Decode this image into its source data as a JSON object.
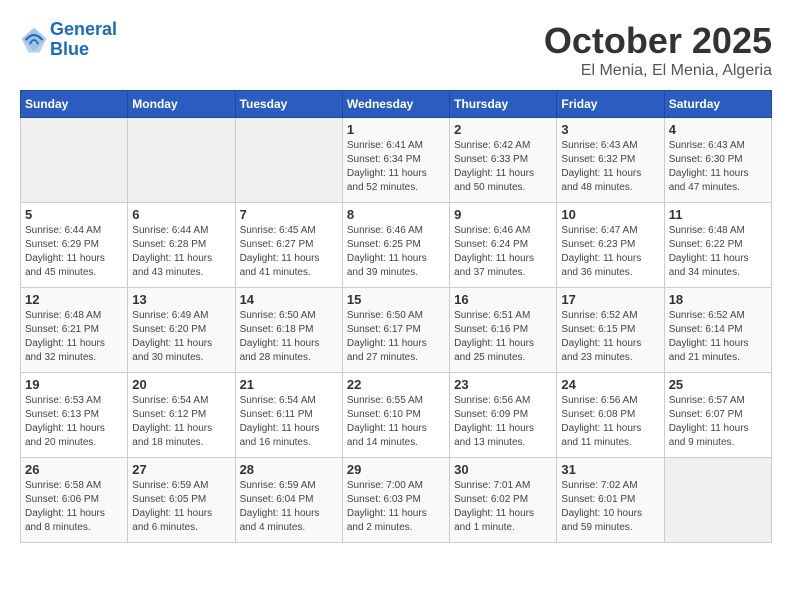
{
  "header": {
    "logo_line1": "General",
    "logo_line2": "Blue",
    "month": "October 2025",
    "location": "El Menia, El Menia, Algeria"
  },
  "days_of_week": [
    "Sunday",
    "Monday",
    "Tuesday",
    "Wednesday",
    "Thursday",
    "Friday",
    "Saturday"
  ],
  "weeks": [
    [
      {
        "day": "",
        "info": ""
      },
      {
        "day": "",
        "info": ""
      },
      {
        "day": "",
        "info": ""
      },
      {
        "day": "1",
        "info": "Sunrise: 6:41 AM\nSunset: 6:34 PM\nDaylight: 11 hours and 52 minutes."
      },
      {
        "day": "2",
        "info": "Sunrise: 6:42 AM\nSunset: 6:33 PM\nDaylight: 11 hours and 50 minutes."
      },
      {
        "day": "3",
        "info": "Sunrise: 6:43 AM\nSunset: 6:32 PM\nDaylight: 11 hours and 48 minutes."
      },
      {
        "day": "4",
        "info": "Sunrise: 6:43 AM\nSunset: 6:30 PM\nDaylight: 11 hours and 47 minutes."
      }
    ],
    [
      {
        "day": "5",
        "info": "Sunrise: 6:44 AM\nSunset: 6:29 PM\nDaylight: 11 hours and 45 minutes."
      },
      {
        "day": "6",
        "info": "Sunrise: 6:44 AM\nSunset: 6:28 PM\nDaylight: 11 hours and 43 minutes."
      },
      {
        "day": "7",
        "info": "Sunrise: 6:45 AM\nSunset: 6:27 PM\nDaylight: 11 hours and 41 minutes."
      },
      {
        "day": "8",
        "info": "Sunrise: 6:46 AM\nSunset: 6:25 PM\nDaylight: 11 hours and 39 minutes."
      },
      {
        "day": "9",
        "info": "Sunrise: 6:46 AM\nSunset: 6:24 PM\nDaylight: 11 hours and 37 minutes."
      },
      {
        "day": "10",
        "info": "Sunrise: 6:47 AM\nSunset: 6:23 PM\nDaylight: 11 hours and 36 minutes."
      },
      {
        "day": "11",
        "info": "Sunrise: 6:48 AM\nSunset: 6:22 PM\nDaylight: 11 hours and 34 minutes."
      }
    ],
    [
      {
        "day": "12",
        "info": "Sunrise: 6:48 AM\nSunset: 6:21 PM\nDaylight: 11 hours and 32 minutes."
      },
      {
        "day": "13",
        "info": "Sunrise: 6:49 AM\nSunset: 6:20 PM\nDaylight: 11 hours and 30 minutes."
      },
      {
        "day": "14",
        "info": "Sunrise: 6:50 AM\nSunset: 6:18 PM\nDaylight: 11 hours and 28 minutes."
      },
      {
        "day": "15",
        "info": "Sunrise: 6:50 AM\nSunset: 6:17 PM\nDaylight: 11 hours and 27 minutes."
      },
      {
        "day": "16",
        "info": "Sunrise: 6:51 AM\nSunset: 6:16 PM\nDaylight: 11 hours and 25 minutes."
      },
      {
        "day": "17",
        "info": "Sunrise: 6:52 AM\nSunset: 6:15 PM\nDaylight: 11 hours and 23 minutes."
      },
      {
        "day": "18",
        "info": "Sunrise: 6:52 AM\nSunset: 6:14 PM\nDaylight: 11 hours and 21 minutes."
      }
    ],
    [
      {
        "day": "19",
        "info": "Sunrise: 6:53 AM\nSunset: 6:13 PM\nDaylight: 11 hours and 20 minutes."
      },
      {
        "day": "20",
        "info": "Sunrise: 6:54 AM\nSunset: 6:12 PM\nDaylight: 11 hours and 18 minutes."
      },
      {
        "day": "21",
        "info": "Sunrise: 6:54 AM\nSunset: 6:11 PM\nDaylight: 11 hours and 16 minutes."
      },
      {
        "day": "22",
        "info": "Sunrise: 6:55 AM\nSunset: 6:10 PM\nDaylight: 11 hours and 14 minutes."
      },
      {
        "day": "23",
        "info": "Sunrise: 6:56 AM\nSunset: 6:09 PM\nDaylight: 11 hours and 13 minutes."
      },
      {
        "day": "24",
        "info": "Sunrise: 6:56 AM\nSunset: 6:08 PM\nDaylight: 11 hours and 11 minutes."
      },
      {
        "day": "25",
        "info": "Sunrise: 6:57 AM\nSunset: 6:07 PM\nDaylight: 11 hours and 9 minutes."
      }
    ],
    [
      {
        "day": "26",
        "info": "Sunrise: 6:58 AM\nSunset: 6:06 PM\nDaylight: 11 hours and 8 minutes."
      },
      {
        "day": "27",
        "info": "Sunrise: 6:59 AM\nSunset: 6:05 PM\nDaylight: 11 hours and 6 minutes."
      },
      {
        "day": "28",
        "info": "Sunrise: 6:59 AM\nSunset: 6:04 PM\nDaylight: 11 hours and 4 minutes."
      },
      {
        "day": "29",
        "info": "Sunrise: 7:00 AM\nSunset: 6:03 PM\nDaylight: 11 hours and 2 minutes."
      },
      {
        "day": "30",
        "info": "Sunrise: 7:01 AM\nSunset: 6:02 PM\nDaylight: 11 hours and 1 minute."
      },
      {
        "day": "31",
        "info": "Sunrise: 7:02 AM\nSunset: 6:01 PM\nDaylight: 10 hours and 59 minutes."
      },
      {
        "day": "",
        "info": ""
      }
    ]
  ]
}
